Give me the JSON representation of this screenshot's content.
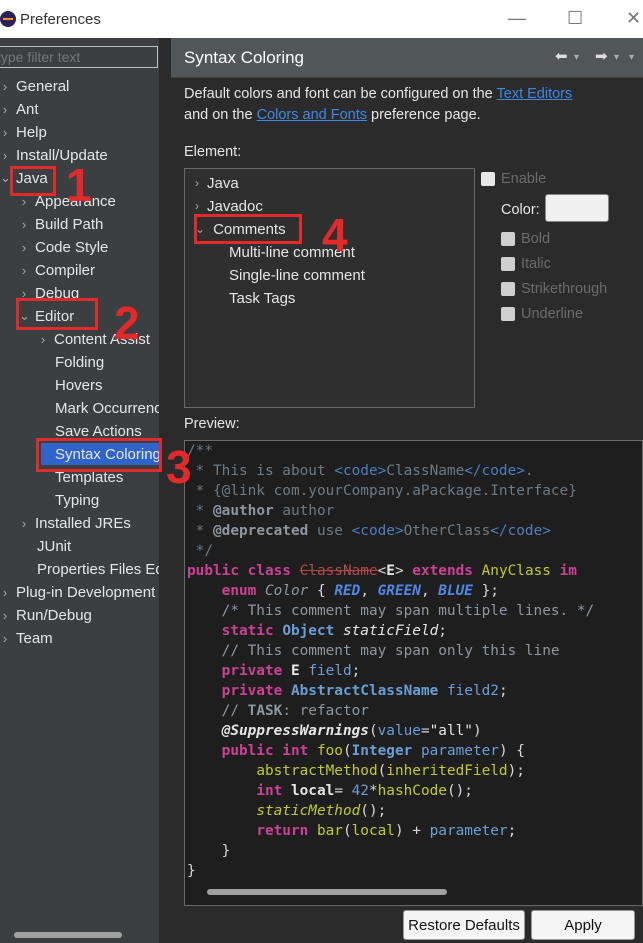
{
  "window": {
    "title": "Preferences"
  },
  "filter": {
    "placeholder": "type filter text"
  },
  "tree": [
    {
      "label": "General"
    },
    {
      "label": "Ant"
    },
    {
      "label": "Help"
    },
    {
      "label": "Install/Update"
    },
    {
      "label": "Java"
    },
    {
      "label": "Appearance"
    },
    {
      "label": "Build Path"
    },
    {
      "label": "Code Style"
    },
    {
      "label": "Compiler"
    },
    {
      "label": "Debug"
    },
    {
      "label": "Editor"
    },
    {
      "label": "Content Assist"
    },
    {
      "label": "Folding"
    },
    {
      "label": "Hovers"
    },
    {
      "label": "Mark Occurrences"
    },
    {
      "label": "Save Actions"
    },
    {
      "label": "Syntax Coloring"
    },
    {
      "label": "Templates"
    },
    {
      "label": "Typing"
    },
    {
      "label": "Installed JREs"
    },
    {
      "label": "JUnit"
    },
    {
      "label": "Properties Files Editor"
    },
    {
      "label": "Plug-in Development"
    },
    {
      "label": "Run/Debug"
    },
    {
      "label": "Team"
    }
  ],
  "page": {
    "title": "Syntax Coloring",
    "desc_pre": "Default colors and font can be configured on the ",
    "link1": "Text Editors",
    "desc_mid": "and on the ",
    "link2": "Colors and Fonts",
    "desc_post": " preference page.",
    "element_label": "Element:",
    "preview_label": "Preview:"
  },
  "elements": [
    {
      "label": "Java"
    },
    {
      "label": "Javadoc"
    },
    {
      "label": "Comments"
    },
    {
      "label": "Multi-line comment"
    },
    {
      "label": "Single-line comment"
    },
    {
      "label": "Task Tags"
    }
  ],
  "options": {
    "enable": "Enable",
    "color": "Color:",
    "bold": "Bold",
    "italic": "Italic",
    "strikethrough": "Strikethrough",
    "underline": "Underline"
  },
  "buttons": {
    "restore": "Restore Defaults",
    "apply": "Apply"
  },
  "annotations": [
    "1",
    "2",
    "3",
    "4"
  ],
  "colors": {
    "annotation": "#e32a2a",
    "selection": "#2f65ca",
    "link": "#3e87e6"
  }
}
